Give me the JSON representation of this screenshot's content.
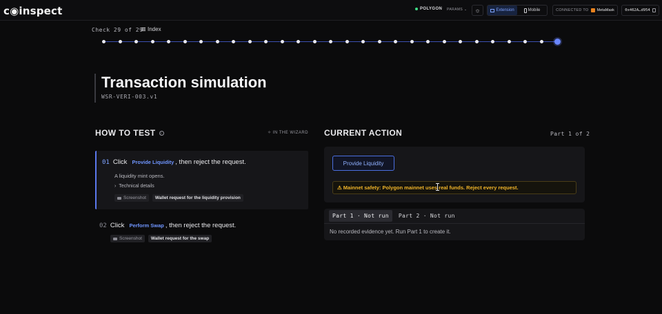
{
  "topbar": {
    "logo": "c◉inspect",
    "network": "POLYGON",
    "params": "PARAMS ⌄",
    "theme_icon": "sun-icon",
    "view_options": [
      {
        "label": "Extension",
        "active": true
      },
      {
        "label": "Mobile",
        "active": false
      }
    ],
    "connected_label": "CONNECTED TO",
    "wallet_name": "MetaMask",
    "address": "0x462A…d954"
  },
  "progress": {
    "check_label": "Check 29 of 29",
    "index_label": "Index",
    "total": 29,
    "current": 29,
    "accent": "#6a86ff"
  },
  "header": {
    "title": "Transaction simulation",
    "code": "WSR-VERI-003.v1"
  },
  "how_to_test": {
    "heading": "HOW TO TEST",
    "wizard_label": "✧ IN THE WIZARD",
    "steps": [
      {
        "number": "01",
        "prefix": "Click",
        "action": "Provide Liquidity",
        "suffix": ", then reject the request.",
        "description": "A liquidity mint opens.",
        "technical": "Technical details",
        "screenshot_label": "Screenshot",
        "screenshot_caption": "Wallet request for the liquidity provision"
      },
      {
        "number": "02",
        "prefix": "Click",
        "action": "Perform Swap",
        "suffix": ", then reject the request.",
        "screenshot_label": "Screenshot",
        "screenshot_caption": "Wallet request for the swap"
      }
    ]
  },
  "current_action": {
    "heading": "CURRENT ACTION",
    "part_of": "Part 1 of 2",
    "button_label": "Provide Liquidity",
    "warning": "⚠ Mainnet safety: Polygon mainnet uses real funds. Reject every request.",
    "warning_color": "#f0b429",
    "tabs": [
      {
        "label": "Part 1 · Not run",
        "active": true
      },
      {
        "label": "Part 2 · Not run",
        "active": false
      }
    ],
    "evidence": "No recorded evidence yet. Run Part 1 to create it."
  }
}
